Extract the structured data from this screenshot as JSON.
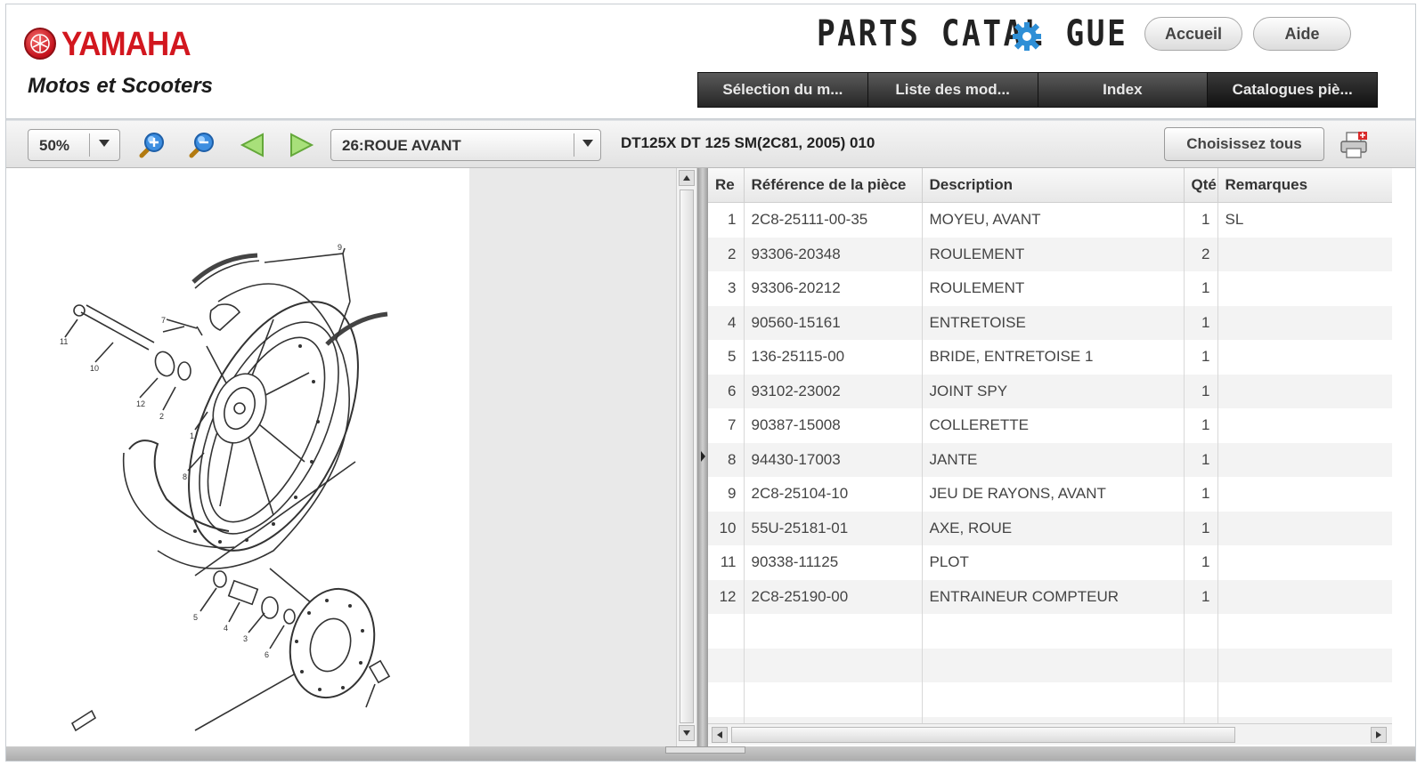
{
  "brand": {
    "logo_text": "YAMAHA",
    "subtitle": "Motos et Scooters",
    "catalogue_title": "PARTS CATAL GUE",
    "accent_red": "#d2171f"
  },
  "header_buttons": {
    "home": "Accueil",
    "help": "Aide"
  },
  "nav_tabs": [
    {
      "label": "Sélection du m..."
    },
    {
      "label": "Liste des mod..."
    },
    {
      "label": "Index"
    },
    {
      "label": "Catalogues piè..."
    }
  ],
  "toolbar": {
    "zoom": "50%",
    "page": "26:ROUE AVANT",
    "model": "DT125X DT 125 SM(2C81, 2005) 010",
    "select_all": "Choisissez tous",
    "icons": [
      "zoom-in-icon",
      "zoom-out-icon",
      "previous-page-icon",
      "next-page-icon",
      "print-icon"
    ]
  },
  "diagram": {
    "callouts": [
      "1",
      "2",
      "3",
      "4",
      "5",
      "6",
      "7",
      "8",
      "9",
      "10",
      "11",
      "12"
    ]
  },
  "parts_table": {
    "columns": [
      "Re",
      "Référence de la pièce",
      "Description",
      "Qté",
      "Remarques"
    ],
    "rows": [
      {
        "ref": "1",
        "part": "2C8-25111-00-35",
        "desc": "MOYEU, AVANT",
        "qty": "1",
        "remarks": "SL"
      },
      {
        "ref": "2",
        "part": "93306-20348",
        "desc": "ROULEMENT",
        "qty": "2",
        "remarks": ""
      },
      {
        "ref": "3",
        "part": "93306-20212",
        "desc": "ROULEMENT",
        "qty": "1",
        "remarks": ""
      },
      {
        "ref": "4",
        "part": "90560-15161",
        "desc": "ENTRETOISE",
        "qty": "1",
        "remarks": ""
      },
      {
        "ref": "5",
        "part": "136-25115-00",
        "desc": "BRIDE, ENTRETOISE 1",
        "qty": "1",
        "remarks": ""
      },
      {
        "ref": "6",
        "part": "93102-23002",
        "desc": "JOINT SPY",
        "qty": "1",
        "remarks": ""
      },
      {
        "ref": "7",
        "part": "90387-15008",
        "desc": "COLLERETTE",
        "qty": "1",
        "remarks": ""
      },
      {
        "ref": "8",
        "part": "94430-17003",
        "desc": "JANTE",
        "qty": "1",
        "remarks": ""
      },
      {
        "ref": "9",
        "part": "2C8-25104-10",
        "desc": "JEU DE RAYONS, AVANT",
        "qty": "1",
        "remarks": ""
      },
      {
        "ref": "10",
        "part": "55U-25181-01",
        "desc": "AXE, ROUE",
        "qty": "1",
        "remarks": ""
      },
      {
        "ref": "11",
        "part": "90338-11125",
        "desc": "PLOT",
        "qty": "1",
        "remarks": ""
      },
      {
        "ref": "12",
        "part": "2C8-25190-00",
        "desc": "ENTRAINEUR COMPTEUR",
        "qty": "1",
        "remarks": ""
      }
    ],
    "empty_rows": 4
  }
}
